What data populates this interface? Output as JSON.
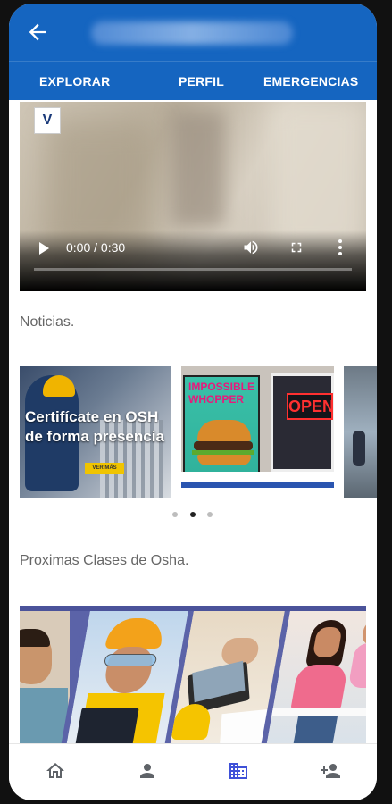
{
  "header": {
    "back_icon": "arrow-back-icon",
    "title": ""
  },
  "tabs": [
    {
      "label": "EXPLORAR"
    },
    {
      "label": "PERFIL"
    },
    {
      "label": "EMERGENCIAS"
    }
  ],
  "video": {
    "logo_text": "V",
    "time": "0:00 / 0:30",
    "progress": 0,
    "controls": [
      "play-icon",
      "volume-icon",
      "fullscreen-icon",
      "more-vert-icon"
    ]
  },
  "news": {
    "title": "Noticias.",
    "cards": [
      {
        "headline": "Certifícate en OSHA de forma presencial",
        "line1": "Certifícate en OSH",
        "line2": "de forma presencia",
        "cta": "VER MÁS"
      },
      {
        "poster": "IMPOSSIBLE WHOPPER",
        "sign": "OPEN"
      },
      {
        "image": "street-scene"
      }
    ],
    "active_dot": 1,
    "dot_count": 3
  },
  "classes": {
    "title": "Proximas Clases de Osha."
  },
  "bottom_nav": {
    "items": [
      {
        "icon": "home-icon"
      },
      {
        "icon": "person-icon"
      },
      {
        "icon": "business-icon",
        "active": true
      },
      {
        "icon": "person-add-icon"
      }
    ]
  },
  "colors": {
    "primary": "#1565c0",
    "active_nav": "#3f51d8",
    "inactive_nav": "#5f6368"
  }
}
